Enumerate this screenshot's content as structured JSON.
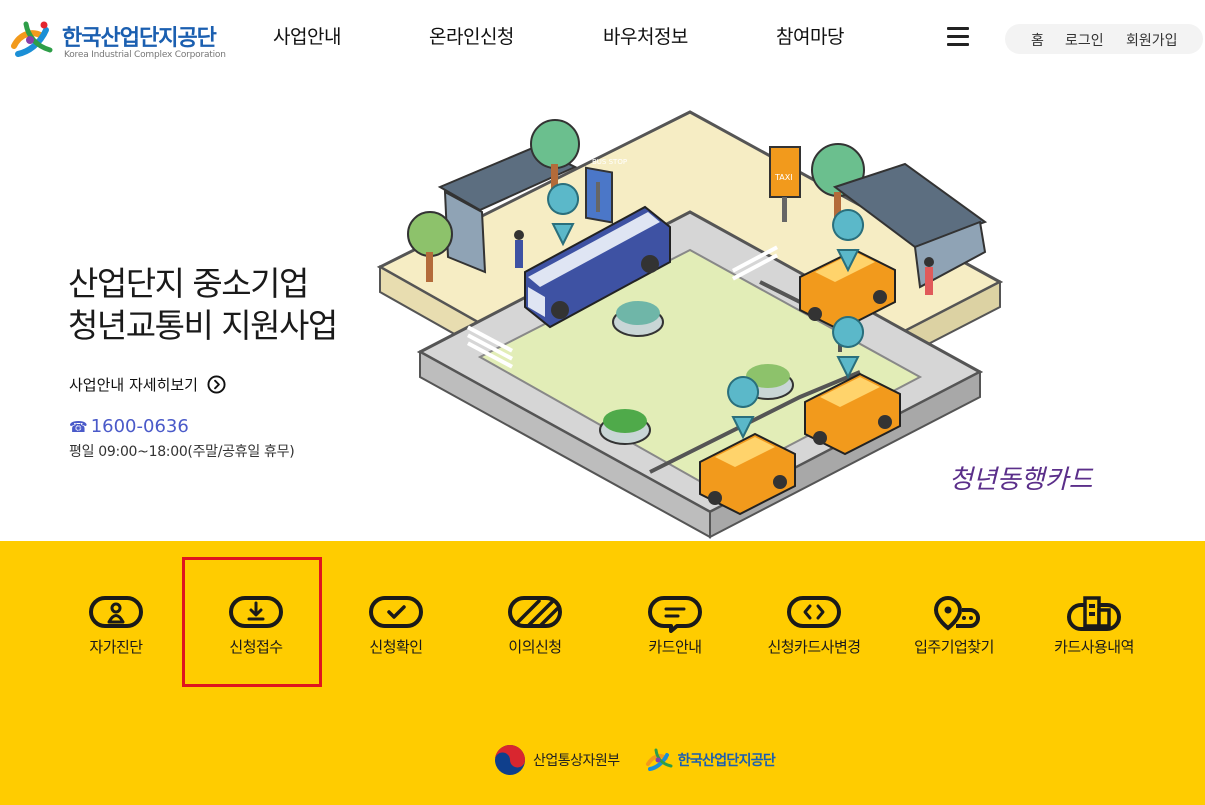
{
  "header": {
    "logo_ko": "한국산업단지공단",
    "logo_en": "Korea Industrial Complex Corporation",
    "nav": [
      "사업안내",
      "온라인신청",
      "바우처정보",
      "참여마당"
    ],
    "util": [
      "홈",
      "로그인",
      "회원가입"
    ]
  },
  "hero": {
    "title_line1": "산업단지 중소기업",
    "title_line2": "청년교통비 지원사업",
    "link_label": "사업안내 자세히보기",
    "phone": "1600-0636",
    "hours": "평일 09:00~18:00(주말/공휴일 휴무)",
    "card_brand": "청년동행카드",
    "bus_sign": "BUS STOP",
    "taxi_sign": "TAXI"
  },
  "quick_menu": [
    {
      "label": "자가진단",
      "icon": "self-check-icon"
    },
    {
      "label": "신청접수",
      "icon": "download-icon"
    },
    {
      "label": "신청확인",
      "icon": "check-icon"
    },
    {
      "label": "이의신청",
      "icon": "slash-icon"
    },
    {
      "label": "카드안내",
      "icon": "message-icon"
    },
    {
      "label": "신청카드사변경",
      "icon": "code-icon"
    },
    {
      "label": "입주기업찾기",
      "icon": "map-pin-icon"
    },
    {
      "label": "카드사용내역",
      "icon": "building-icon"
    }
  ],
  "footer": {
    "org1": "산업통상자원부",
    "org2": "한국산업단지공단"
  },
  "colors": {
    "accent_yellow": "#ffcc00",
    "brand_blue": "#1b5fb0",
    "phone_blue": "#4a5ac9",
    "highlight_red": "#e0141e"
  }
}
